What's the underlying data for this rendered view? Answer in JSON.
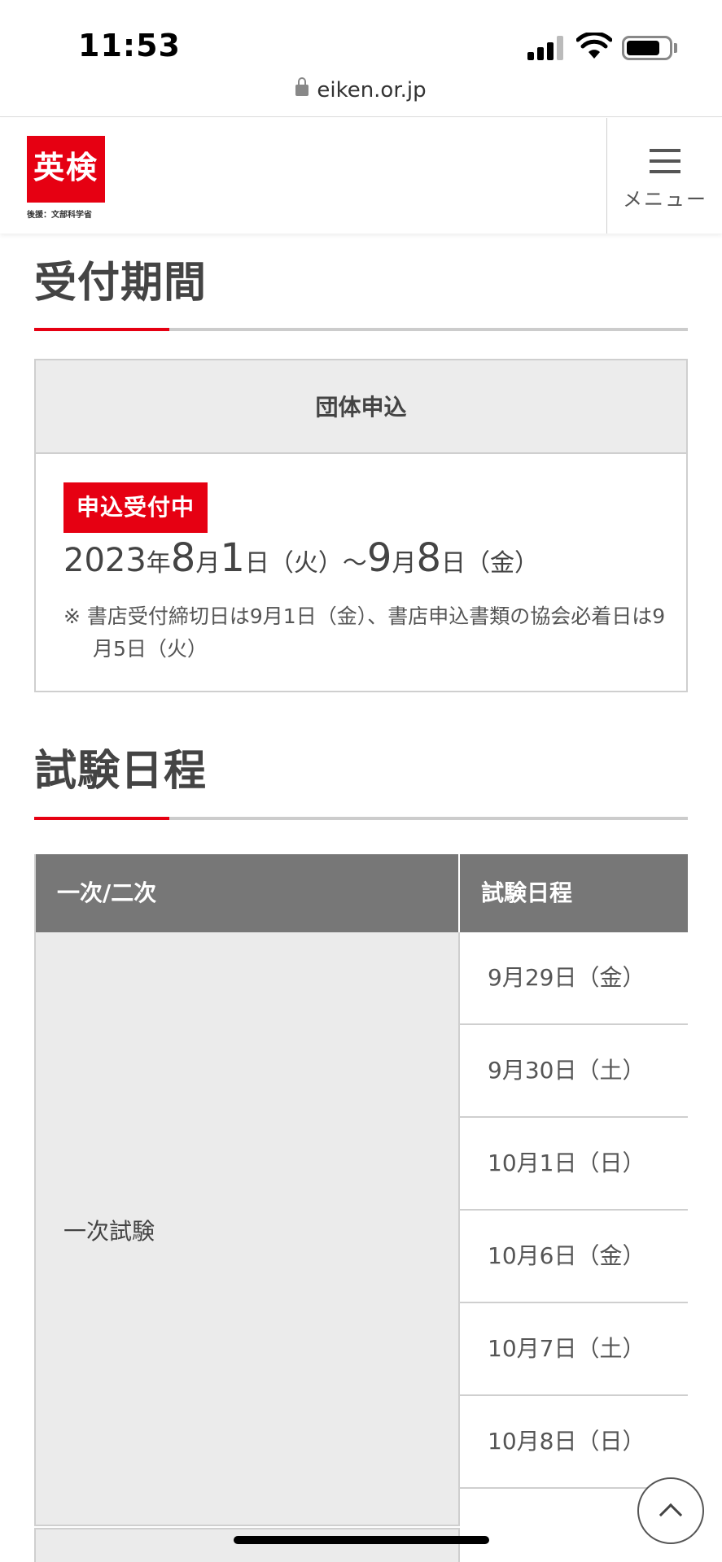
{
  "status_bar": {
    "time": "11:53"
  },
  "browser": {
    "url": "eiken.or.jp"
  },
  "header": {
    "logo_text": "英検",
    "logo_subtext": "後援：文部科学省",
    "menu_label": "メニュー",
    "brand_color": "#e60012"
  },
  "reception": {
    "section_title": "受付期間",
    "box_header": "団体申込",
    "status_badge": "申込受付中",
    "date_range": {
      "start_year": "2023",
      "start_month": "8",
      "start_day": "1",
      "start_weekday": "（火）",
      "end_month": "9",
      "end_day": "8",
      "end_weekday": "（金）"
    },
    "note": "※ 書店受付締切日は9月1日（金）、書店申込書類の協会必着日は9月5日（火）"
  },
  "schedule": {
    "section_title": "試験日程",
    "columns": [
      "一次/二次",
      "試験日程"
    ],
    "first_stage_label": "一次試験",
    "first_stage_dates": [
      "9月29日（金）",
      "9月30日（土）",
      "10月1日（日）",
      "10月6日（金）",
      "10月7日（土）",
      "10月8日（日）"
    ]
  }
}
